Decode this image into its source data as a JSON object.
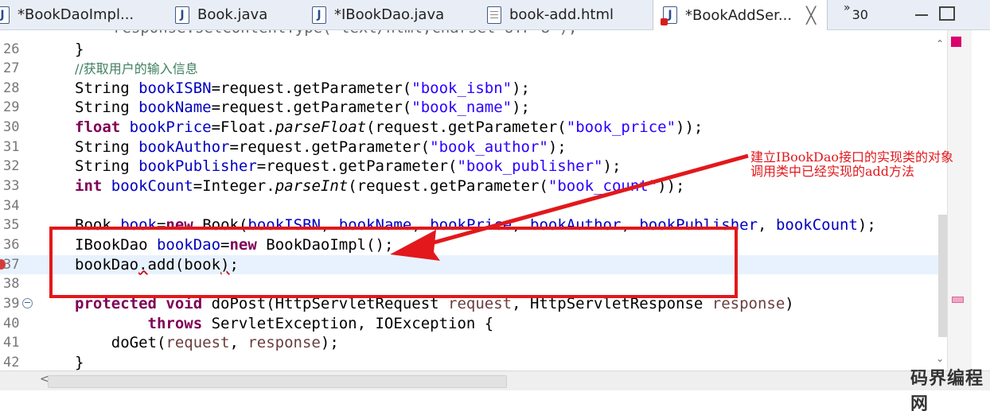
{
  "tabs": [
    {
      "label": "*BookDaoImpl...",
      "icon": "java-file-icon",
      "active": false
    },
    {
      "label": "Book.java",
      "icon": "java-file-icon",
      "active": false
    },
    {
      "label": "*IBookDao.java",
      "icon": "java-file-icon",
      "active": false
    },
    {
      "label": "book-add.html",
      "icon": "html-file-icon",
      "active": false
    },
    {
      "label": "*BookAddSer...",
      "icon": "java-file-error-icon",
      "active": true,
      "close": "╳"
    }
  ],
  "tab_overflow": {
    "chevron": "»",
    "count": "30"
  },
  "code_lines": [
    {
      "n": "26",
      "html": "}"
    },
    {
      "n": "27",
      "html": "<span class=\"cmt\">//获取用户的输入信息</span>"
    },
    {
      "n": "28",
      "html": "String <span class=\"fld\">bookISBN</span>=request.getParameter(<span class=\"str\">\"book_isbn\"</span>);"
    },
    {
      "n": "29",
      "html": "String <span class=\"fld\">bookName</span>=request.getParameter(<span class=\"str\">\"book_name\"</span>);"
    },
    {
      "n": "30",
      "html": "<span class=\"kw\">float</span> <span class=\"fld\">bookPrice</span>=Float.<span class=\"ital\">parseFloat</span>(request.getParameter(<span class=\"str\">\"book_price\"</span>));"
    },
    {
      "n": "31",
      "html": "String <span class=\"fld\">bookAuthor</span>=request.getParameter(<span class=\"str\">\"book_author\"</span>);"
    },
    {
      "n": "32",
      "html": "String <span class=\"fld\">bookPublisher</span>=request.getParameter(<span class=\"str\">\"book_publisher\"</span>);"
    },
    {
      "n": "33",
      "html": "<span class=\"kw\">int</span> <span class=\"fld\">bookCount</span>=Integer.<span class=\"ital\">parseInt</span>(request.getParameter(<span class=\"str\">\"book_count\"</span>));"
    },
    {
      "n": "34",
      "html": ""
    },
    {
      "n": "35",
      "html": "Book <span class=\"fld\">book</span>=<span class=\"kw\">new</span> Book(<span class=\"fld\">bookISBN</span>, <span class=\"fld\">bookName</span>, <span class=\"fld\">bookPrice</span>, <span class=\"fld\">bookAuthor</span>, <span class=\"fld\">bookPublisher</span>, <span class=\"fld\">bookCount</span>);"
    },
    {
      "n": "36",
      "html": "IBookDao <span class=\"fld\">bookDao</span>=<span class=\"kw\">new</span> BookDaoImpl();"
    },
    {
      "n": "37",
      "html": "bookDao<span class=\"squig\">.</span>add(book<span class=\"squig\">)</span>;",
      "current": true,
      "breakpoint": true
    },
    {
      "n": "38",
      "html": ""
    },
    {
      "n": "39",
      "html": "<span class=\"kw\">protected</span> <span class=\"kw\">void</span> doPost(HttpServletRequest <span class=\"param\">request</span>, HttpServletResponse <span class=\"param\">response</span>)",
      "fold": "−",
      "outdent": true
    },
    {
      "n": "40",
      "html": "        <span class=\"kw\">throws</span> ServletException, IOException {",
      "outdent": true
    },
    {
      "n": "41",
      "html": "    doGet(<span class=\"param\">request</span>, <span class=\"param\">response</span>);",
      "outdent": true
    },
    {
      "n": "42",
      "html": "}",
      "outdent": true
    }
  ],
  "annotation": {
    "line1": "建立IBookDao接口的实现类的对象",
    "line2": "调用类中已经实现的add方法",
    "color": "#e2181c"
  },
  "watermark": "码界编程网",
  "colors": {
    "keyword": "#7f0055",
    "field": "#0000c0",
    "string": "#2a00ff",
    "comment": "#3f7f5f",
    "highlight": "#e2181c"
  }
}
